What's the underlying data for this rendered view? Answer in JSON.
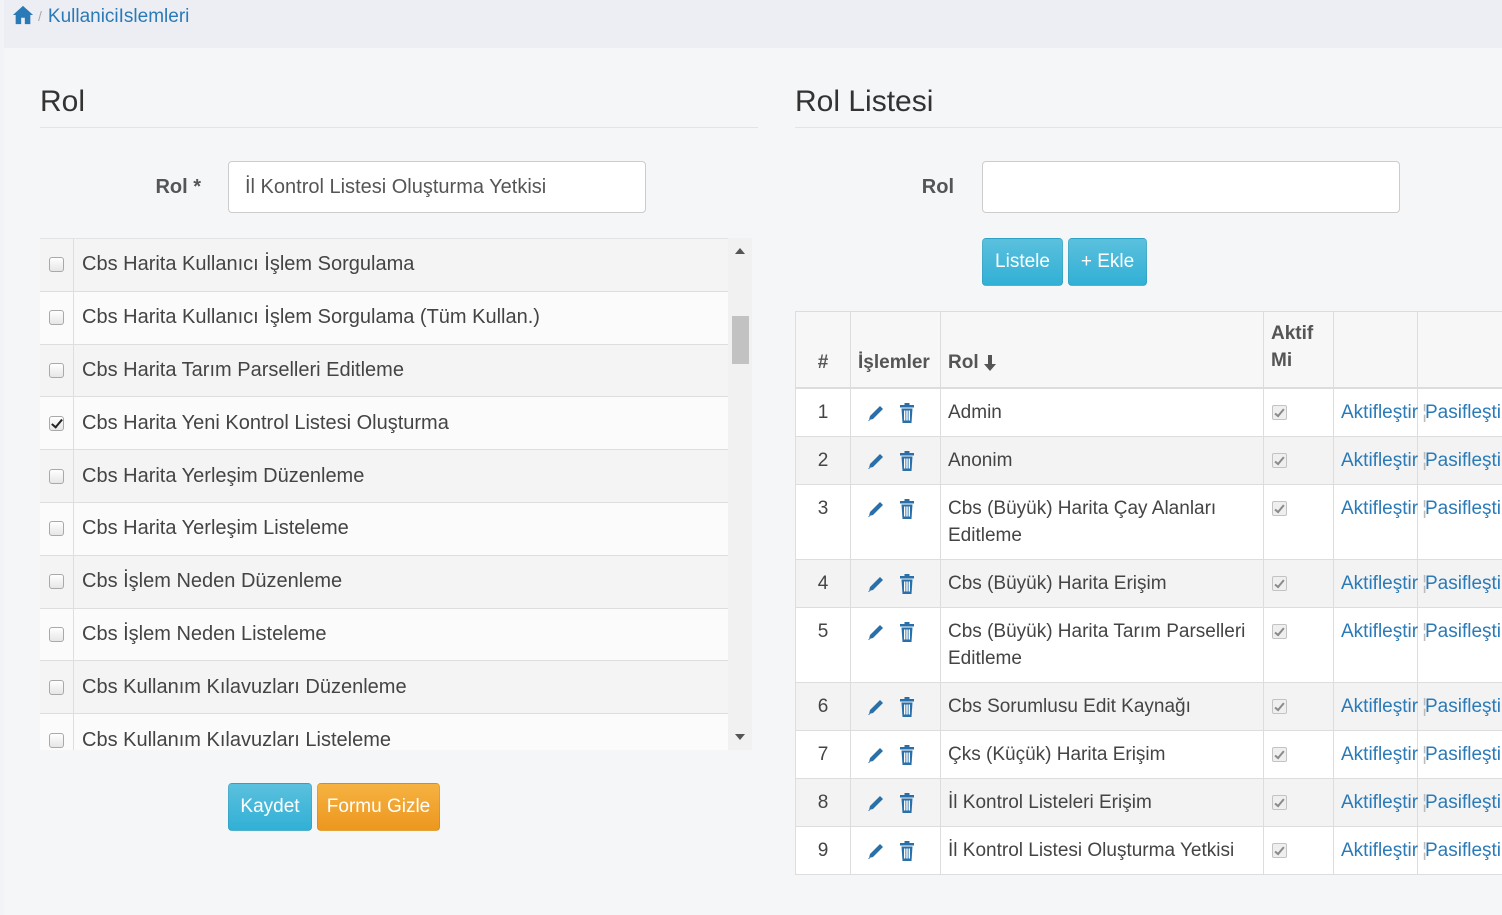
{
  "breadcrumb": {
    "current": "KullaniciIslemleri"
  },
  "left_panel": {
    "title": "Rol",
    "rol_label": "Rol *",
    "rol_value": "İl Kontrol Listesi Oluşturma Yetkisi",
    "permissions": [
      {
        "label": "Cbs Harita Kullanıcı İşlem Sorgulama",
        "checked": false
      },
      {
        "label": "Cbs Harita Kullanıcı İşlem Sorgulama (Tüm Kullan.)",
        "checked": false
      },
      {
        "label": "Cbs Harita Tarım Parselleri Editleme",
        "checked": false
      },
      {
        "label": "Cbs Harita Yeni Kontrol Listesi Oluşturma",
        "checked": true
      },
      {
        "label": "Cbs Harita Yerleşim Düzenleme",
        "checked": false
      },
      {
        "label": "Cbs Harita Yerleşim Listeleme",
        "checked": false
      },
      {
        "label": "Cbs İşlem Neden Düzenleme",
        "checked": false
      },
      {
        "label": "Cbs İşlem Neden Listeleme",
        "checked": false
      },
      {
        "label": "Cbs Kullanım Kılavuzları Düzenleme",
        "checked": false
      },
      {
        "label": "Cbs Kullanım Kılavuzları Listeleme",
        "checked": false
      }
    ],
    "save_label": "Kaydet",
    "hide_form_label": "Formu Gizle"
  },
  "right_panel": {
    "title": "Rol Listesi",
    "search_label": "Rol",
    "search_value": "",
    "list_label": "Listele",
    "add_label": "+ Ekle",
    "table": {
      "headers": {
        "num": "#",
        "ops": "İşlemler",
        "rol": "Rol",
        "aktif_line1": "Aktif",
        "aktif_line2": "Mi"
      },
      "activate_label": "Aktifleştir",
      "deactivate_label": "Pasifleştir",
      "rows": [
        {
          "num": "1",
          "rol": "Admin",
          "aktif": true
        },
        {
          "num": "2",
          "rol": "Anonim",
          "aktif": true
        },
        {
          "num": "3",
          "rol": "Cbs (Büyük) Harita Çay Alanları Editleme",
          "aktif": true
        },
        {
          "num": "4",
          "rol": "Cbs (Büyük) Harita Erişim",
          "aktif": true
        },
        {
          "num": "5",
          "rol": "Cbs (Büyük) Harita Tarım Parselleri Editleme",
          "aktif": true
        },
        {
          "num": "6",
          "rol": "Cbs Sorumlusu Edit Kaynağı",
          "aktif": true
        },
        {
          "num": "7",
          "rol": "Çks (Küçük) Harita Erişim",
          "aktif": true
        },
        {
          "num": "8",
          "rol": "İl Kontrol Listeleri Erişim",
          "aktif": true
        },
        {
          "num": "9",
          "rol": "İl Kontrol Listesi Oluşturma Yetkisi",
          "aktif": true
        }
      ]
    }
  },
  "colors": {
    "link": "#2a7ab8",
    "info_button": "#5bc0de",
    "warning_button": "#f0ad4e"
  }
}
